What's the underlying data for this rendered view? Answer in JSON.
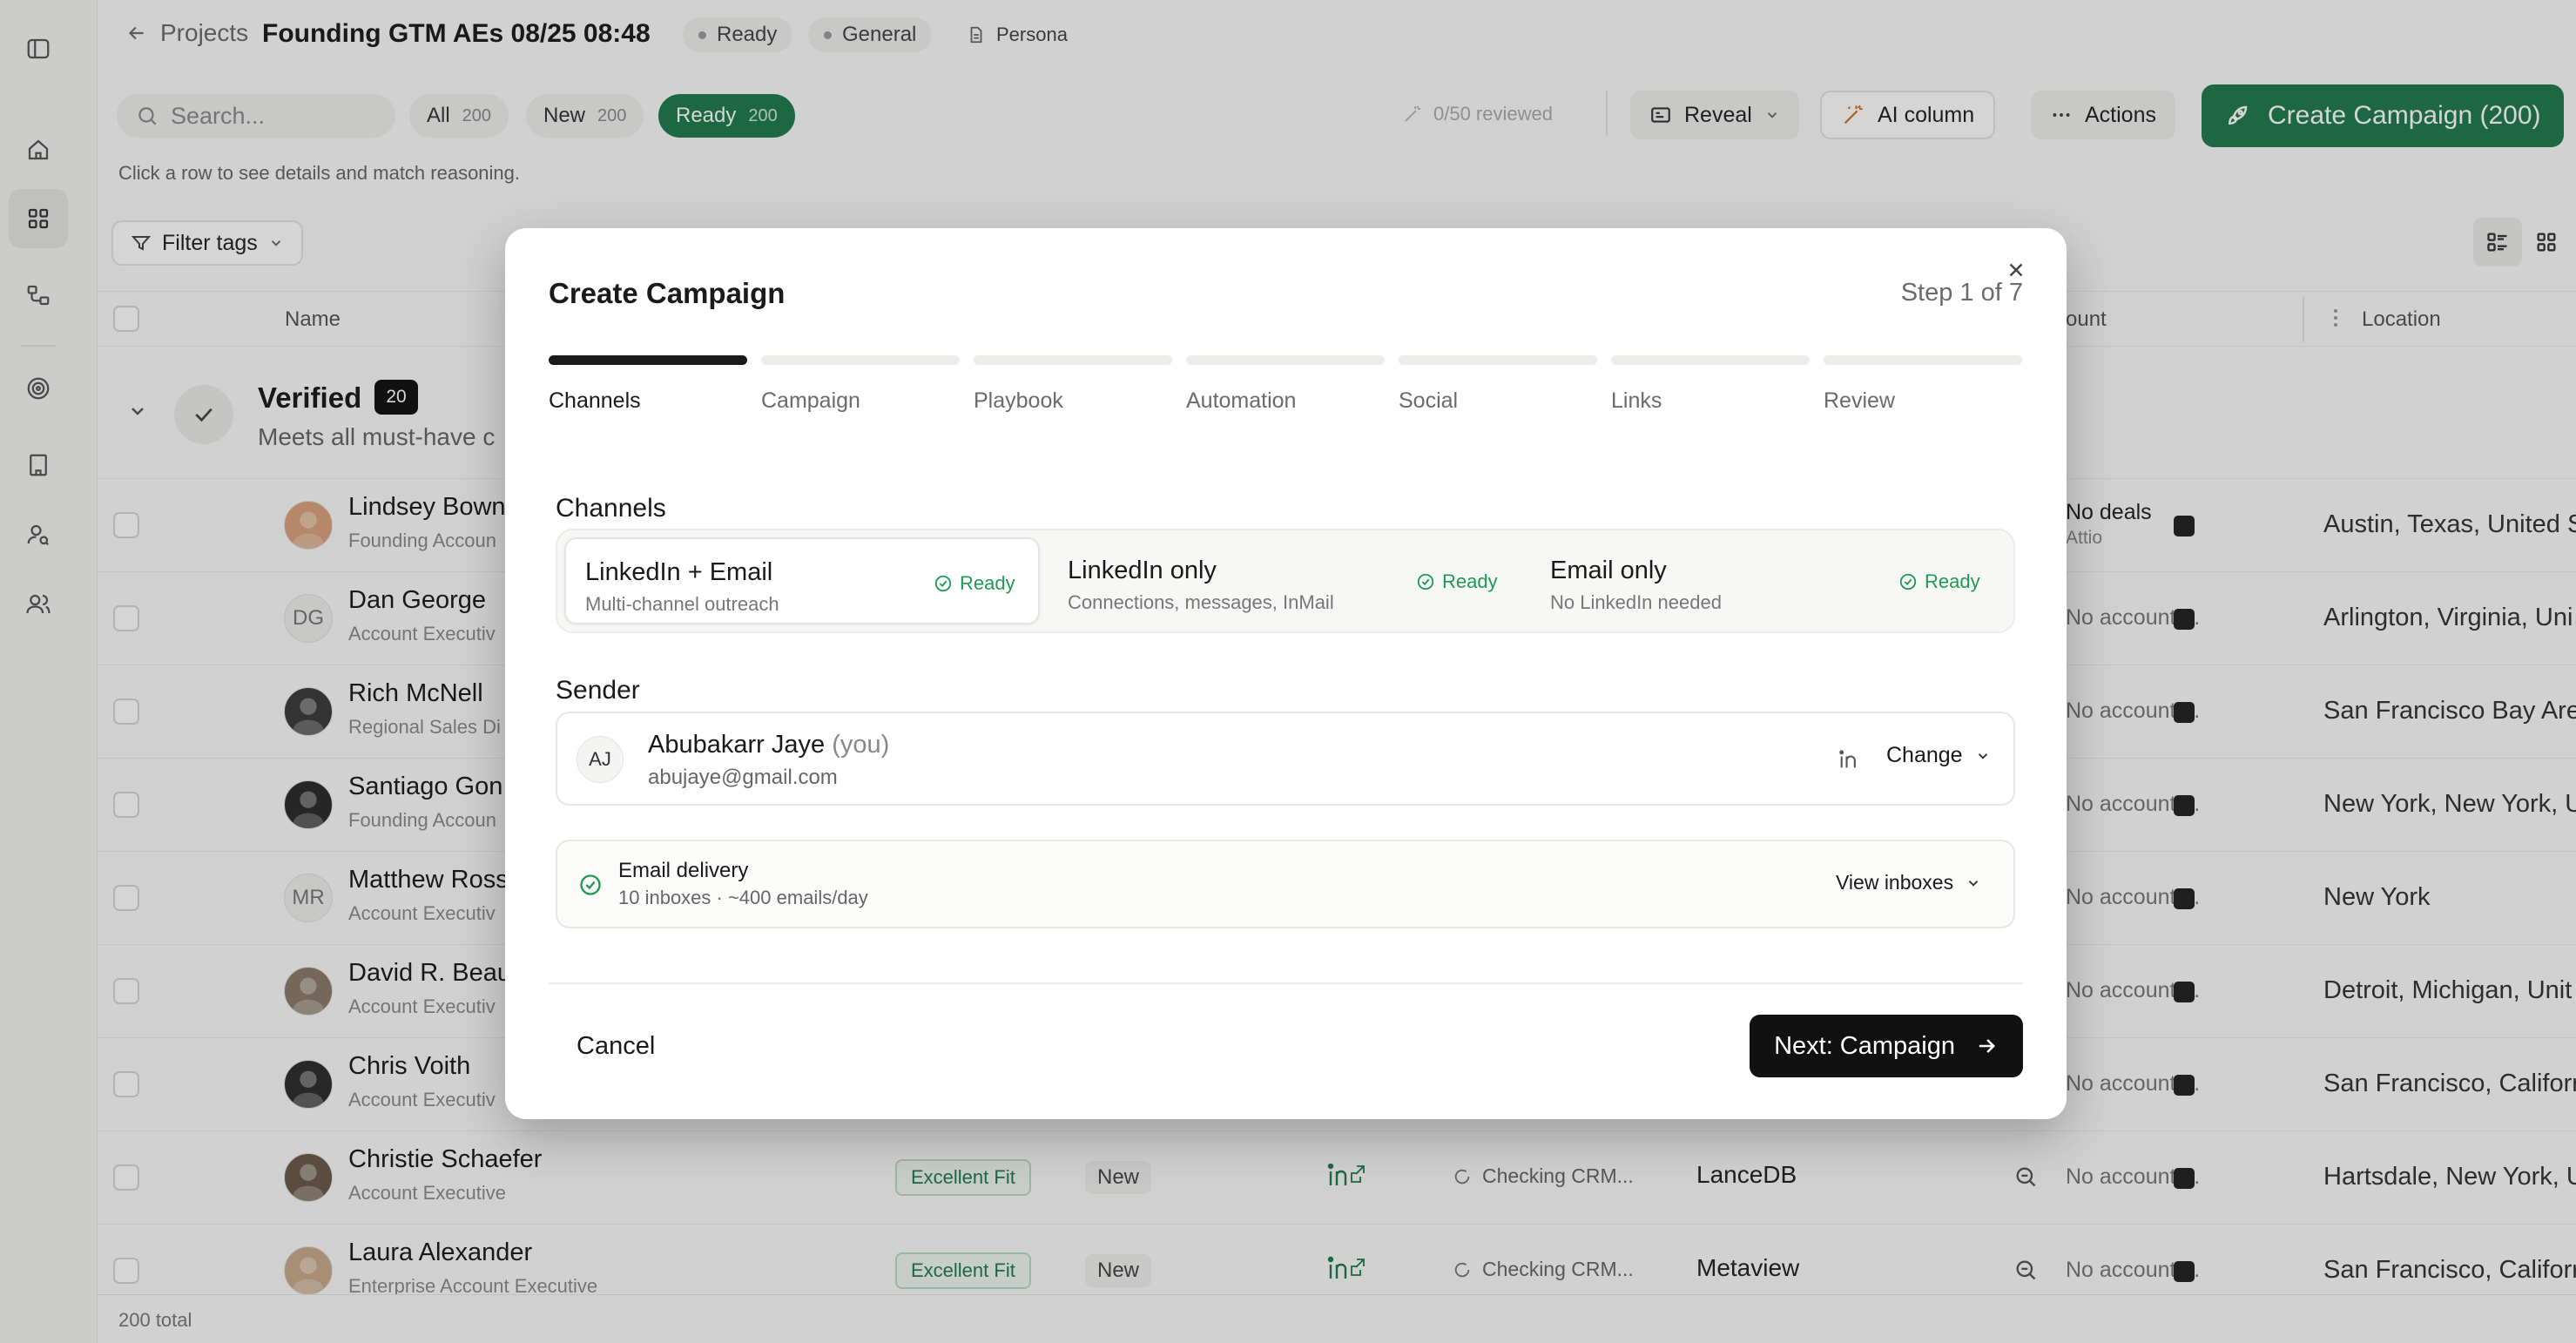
{
  "header": {
    "back_label": "Projects",
    "project_title": "Founding GTM AEs 08/25 08:48",
    "status_chip": "Ready",
    "type_chip": "General",
    "persona_chip": "Persona"
  },
  "toolbar": {
    "search_placeholder": "Search...",
    "segments": [
      {
        "label": "All",
        "count": "200"
      },
      {
        "label": "New",
        "count": "200"
      },
      {
        "label": "Ready",
        "count": "200"
      }
    ],
    "reviewed": "0/50 reviewed",
    "reveal_label": "Reveal",
    "ai_column_label": "AI column",
    "actions_label": "Actions",
    "create_campaign_label": "Create Campaign  (200)"
  },
  "hint": "Click a row to see details and match reasoning.",
  "filter_label": "Filter tags",
  "table": {
    "col_name": "Name",
    "col_account": "ount",
    "col_location": "Location",
    "group": {
      "title": "Verified",
      "count": "20",
      "subtitle": "Meets all must-have c"
    },
    "rows": [
      {
        "name": "Lindsey Bown",
        "role": "Founding Accoun",
        "initials": "",
        "account": "No deals",
        "account_sub": "Attio",
        "location": "Austin, Texas, United S"
      },
      {
        "name": "Dan George",
        "role": "Account Executiv",
        "initials": "DG",
        "account": "No account ...",
        "location": "Arlington, Virginia, Uni"
      },
      {
        "name": "Rich McNell",
        "role": "Regional Sales Di",
        "initials": "",
        "account": "No account ...",
        "location": "San Francisco Bay Are"
      },
      {
        "name": "Santiago Gon",
        "role": "Founding Accoun",
        "initials": "",
        "account": "No account ...",
        "location": "New York, New York, U"
      },
      {
        "name": "Matthew Ross",
        "role": "Account Executiv",
        "initials": "MR",
        "account": "No account ...",
        "location": "New York"
      },
      {
        "name": "David R. Beau",
        "role": "Account Executiv",
        "initials": "",
        "account": "No account ...",
        "location": "Detroit, Michigan, Unit"
      },
      {
        "name": "Chris Voith",
        "role": "Account Executiv",
        "initials": "",
        "account": "No account ...",
        "location": "San Francisco, Califorr"
      },
      {
        "name": "Christie Schaefer",
        "role": "Account Executive",
        "initials": "",
        "fit": "Excellent Fit",
        "status": "New",
        "crm": "Checking CRM...",
        "company": "LanceDB",
        "account": "No account ...",
        "location": "Hartsdale, New York, U"
      },
      {
        "name": "Laura Alexander",
        "role": "Enterprise Account Executive",
        "initials": "",
        "fit": "Excellent Fit",
        "status": "New",
        "crm": "Checking CRM...",
        "company": "Metaview",
        "account": "No account ...",
        "location": "San Francisco, Califorr"
      }
    ],
    "total": "200 total"
  },
  "modal": {
    "title": "Create Campaign",
    "step": "Step 1 of 7",
    "steps": [
      "Channels",
      "Campaign",
      "Playbook",
      "Automation",
      "Social",
      "Links",
      "Review"
    ],
    "channels_label": "Channels",
    "channels": [
      {
        "title": "LinkedIn + Email",
        "subtitle": "Multi-channel outreach",
        "status": "Ready"
      },
      {
        "title": "LinkedIn only",
        "subtitle": "Connections, messages, InMail",
        "status": "Ready"
      },
      {
        "title": "Email only",
        "subtitle": "No LinkedIn needed",
        "status": "Ready"
      }
    ],
    "sender_label": "Sender",
    "sender": {
      "initials": "AJ",
      "name": "Abubakarr Jaye",
      "you": "(you)",
      "email": "abujaye@gmail.com",
      "change_label": "Change"
    },
    "email_delivery": {
      "title": "Email delivery",
      "subtitle": "10 inboxes · ~400 emails/day",
      "action": "View inboxes"
    },
    "cancel_label": "Cancel",
    "next_label": "Next: Campaign"
  },
  "colors": {
    "brand": "#1f7a4d",
    "ready": "#1f9a55",
    "dark": "#111111"
  }
}
